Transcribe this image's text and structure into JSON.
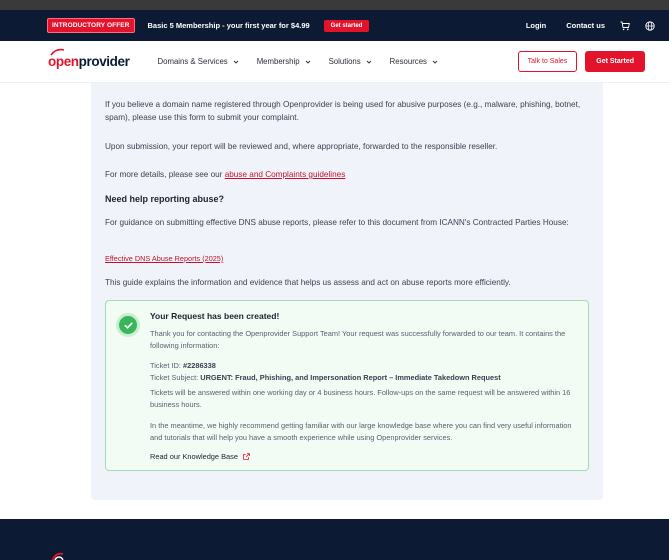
{
  "promo": {
    "badge": "INTRODUCTORY OFFER",
    "text": "Basic 5 Membership - your first year for $4.99",
    "cta": "Get started",
    "login": "Login",
    "contact": "Contact us"
  },
  "nav": {
    "logo_open": "open",
    "logo_provider": "provider",
    "menu": [
      "Domains & Services",
      "Membership",
      "Solutions",
      "Resources"
    ],
    "talk_to_sales": "Talk to Sales",
    "get_started": "Get Started"
  },
  "content": {
    "intro": "If you believe a domain name registered through Openprovider is being used for abusive purposes (e.g., malware, phishing, botnet, spam), please use this form to submit your complaint.",
    "review": "Upon submission, your report will be reviewed and, where appropriate, forwarded to the responsible reseller.",
    "details_prefix": "For more details, please see our ",
    "details_link": "abuse and Complaints guidelines",
    "help_heading": "Need help reporting abuse?",
    "guidance": "For guidance on submitting effective DNS abuse reports, please refer to this document from ICANN's Contracted Parties House:",
    "doc_link": "Effective DNS Abuse Reports (2025)",
    "guide_text": "This guide explains the information and evidence that helps us assess and act on abuse reports more efficiently."
  },
  "success": {
    "title": "Your Request has been created!",
    "thanks": "Thank you for contacting the Openprovider Support Team! Your request was successfully forwarded to our team. It contains the following information:",
    "ticket_id_label": "Ticket ID: ",
    "ticket_id": "#2286338",
    "ticket_subject_label": "Ticket Subject: ",
    "ticket_subject": "URGENT: Fraud, Phishing, and Impersonation Report – Immediate Takedown Request",
    "response_time": "Tickets will be answered within one working day or 4 business hours. Follow-ups on the same request will be answered within 16 business hours.",
    "kb_text": "In the meantime, we highly recommend getting familiar with our large knowledge base where you can find very useful information and tutorials that will help you have a smooth experience while using Openprovider services.",
    "kb_link": "Read our Knowledge Base"
  },
  "colors": {
    "brand_red": "#e3132c",
    "navy": "#0c1a33",
    "success_green": "#39b65a"
  },
  "icons": {
    "cart": "cart-icon",
    "globe": "globe-icon",
    "chevron": "chevron-down-icon",
    "check": "check-circle-icon",
    "external": "external-link-icon"
  }
}
